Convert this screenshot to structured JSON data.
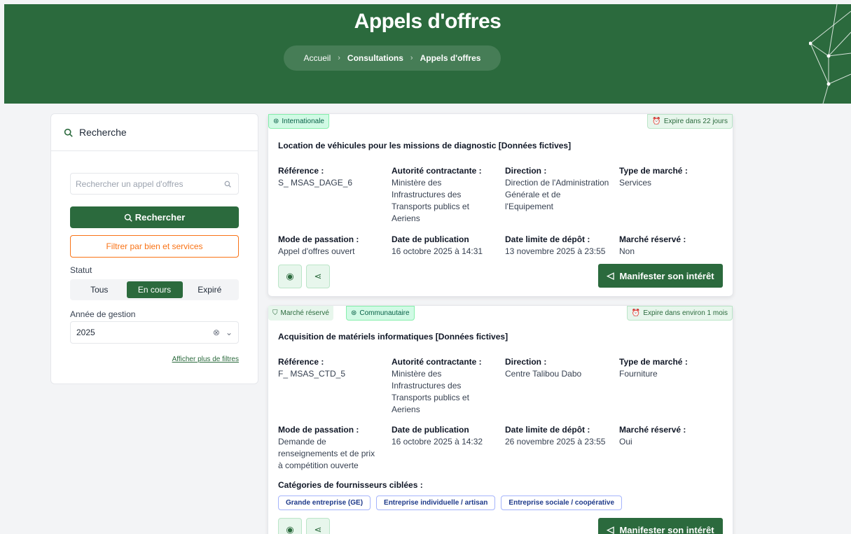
{
  "header": {
    "title": "Appels d'offres",
    "breadcrumb": [
      "Accueil",
      "Consultations",
      "Appels d'offres"
    ]
  },
  "sidebar": {
    "title": "Recherche",
    "search_placeholder": "Rechercher un appel d'offres",
    "search_button": "Rechercher",
    "filter_button": "Filtrer par bien et services",
    "status_label": "Statut",
    "status_options": [
      "Tous",
      "En cours",
      "Expiré"
    ],
    "status_selected": "En cours",
    "year_label": "Année de gestion",
    "year_value": "2025",
    "more_filters": "Afficher plus de filtres"
  },
  "cards": [
    {
      "tags": [
        "Internationale"
      ],
      "expire": "Expire dans 22 jours",
      "title": "Location de véhicules pour les missions de diagnostic [Données fictives]",
      "reference_label": "Référence :",
      "reference": "S_ MSAS_DAGE_6",
      "authority_label": "Autorité contractante :",
      "authority": "Ministère des Infrastructures des Transports publics et Aeriens",
      "direction_label": "Direction :",
      "direction": "Direction de l'Administration Générale et de l'Equipement",
      "market_type_label": "Type de marché :",
      "market_type": "Services",
      "mode_label": "Mode de passation :",
      "mode": "Appel d'offres ouvert",
      "pub_label": "Date de publication",
      "pub_date": "16 octobre 2025 à 14:31",
      "deadline_label": "Date limite de dépôt :",
      "deadline": "13 novembre 2025 à 23:55",
      "reserved_label": "Marché réservé :",
      "reserved": "Non",
      "interest_button": "Manifester son intérêt"
    },
    {
      "tags": [
        "Marché réservé",
        "Communautaire"
      ],
      "expire": "Expire dans environ 1 mois",
      "title": "Acquisition de matériels informatiques [Données fictives]",
      "reference_label": "Référence :",
      "reference": "F_ MSAS_CTD_5",
      "authority_label": "Autorité contractante :",
      "authority": "Ministère des Infrastructures des Transports publics et Aeriens",
      "direction_label": "Direction :",
      "direction": "Centre Talibou Dabo",
      "market_type_label": "Type de marché :",
      "market_type": "Fourniture",
      "mode_label": "Mode de passation :",
      "mode": "Demande de renseignements et de prix à compétition ouverte",
      "pub_label": "Date de publication",
      "pub_date": "16 octobre 2025 à 14:32",
      "deadline_label": "Date limite de dépôt :",
      "deadline": "26 novembre 2025 à 23:55",
      "reserved_label": "Marché réservé :",
      "reserved": "Oui",
      "categories_label": "Catégories de fournisseurs ciblées :",
      "categories": [
        "Grande entreprise (GE)",
        "Entreprise individuelle / artisan",
        "Entreprise sociale / coopérative"
      ],
      "interest_button": "Manifester son intérêt"
    }
  ],
  "icons": {
    "search": "search-icon",
    "globe": "globe-icon",
    "alarm": "alarm-clock-icon",
    "shield": "shield-check-icon",
    "eye": "eye-icon",
    "share": "share-icon",
    "megaphone": "megaphone-icon",
    "clear": "clear-icon",
    "chevron": "chevron-down-icon"
  },
  "colors": {
    "primary": "#2b6a3d",
    "accent": "#f97316",
    "chip_border": "#a5b4fc"
  }
}
